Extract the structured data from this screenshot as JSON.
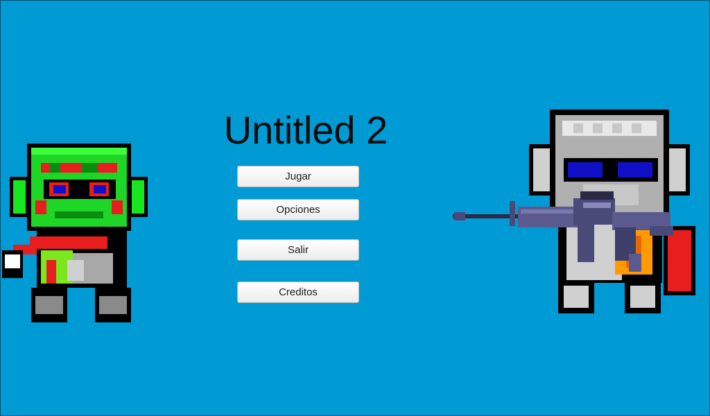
{
  "title": "Untitled 2",
  "menu": {
    "items": [
      {
        "label": "Jugar"
      },
      {
        "label": "Opciones"
      },
      {
        "label": "Salir"
      },
      {
        "label": "Creditos"
      }
    ]
  },
  "colors": {
    "background": "#009bd4",
    "button": "#f3f3f3",
    "title_text": "#0b0b0b",
    "zombie_green": "#18e61f",
    "scarf_red": "#e81e1e",
    "goggles_blue": "#1010c8",
    "rifle_purple": "#5a5a8e"
  },
  "characters": {
    "left": {
      "icon": "zombie-character-icon"
    },
    "right": {
      "icon": "soldier-with-rifle-icon"
    }
  }
}
